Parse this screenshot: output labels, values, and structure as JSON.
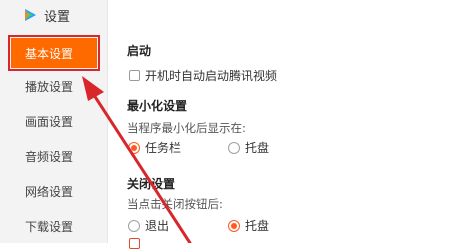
{
  "app": {
    "title": "设置",
    "icon": "tencent-video-logo-icon"
  },
  "sidebar": {
    "items": [
      {
        "label": "基本设置",
        "active": true
      },
      {
        "label": "播放设置"
      },
      {
        "label": "画面设置"
      },
      {
        "label": "音频设置"
      },
      {
        "label": "网络设置"
      },
      {
        "label": "下载设置"
      }
    ]
  },
  "main": {
    "startup": {
      "title": "启动",
      "option": "开机时自动启动腾讯视频",
      "checked": false
    },
    "minimize": {
      "title": "最小化设置",
      "desc": "当程序最小化后显示在:",
      "options": [
        {
          "label": "任务栏",
          "checked": true
        },
        {
          "label": "托盘",
          "checked": false
        }
      ]
    },
    "close": {
      "title": "关闭设置",
      "desc": "当点击关闭按钮后:",
      "options": [
        {
          "label": "退出",
          "checked": false
        },
        {
          "label": "托盘",
          "checked": true
        }
      ]
    }
  },
  "colors": {
    "accent": "#ff6a00",
    "annotation": "#d8262b"
  }
}
